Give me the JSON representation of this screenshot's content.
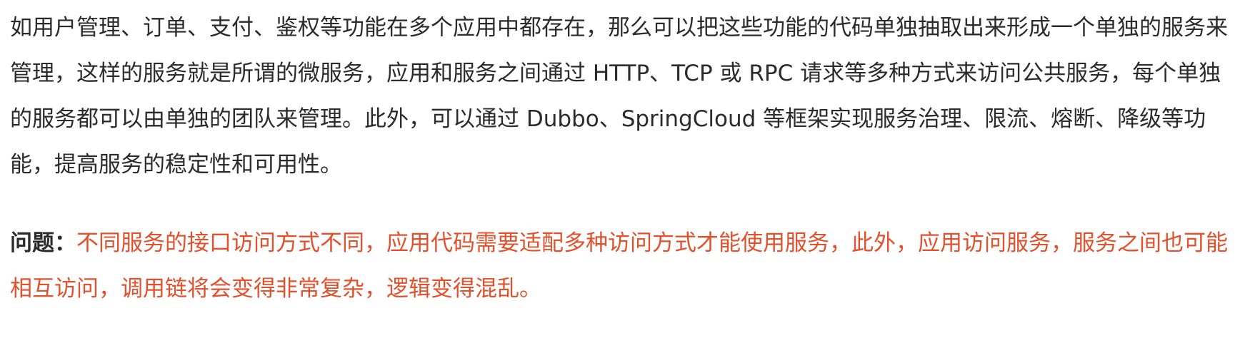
{
  "paragraph_1": "如用户管理、订单、支付、鉴权等功能在多个应用中都存在，那么可以把这些功能的代码单独抽取出来形成一个单独的服务来管理，这样的服务就是所谓的微服务，应用和服务之间通过 HTTP、TCP 或 RPC 请求等多种方式来访问公共服务，每个单独的服务都可以由单独的团队来管理。此外，可以通过 Dubbo、SpringCloud 等框架实现服务治理、限流、熔断、降级等功能，提高服务的稳定性和可用性。",
  "problem": {
    "label": "问题：",
    "text": "不同服务的接口访问方式不同，应用代码需要适配多种访问方式才能使用服务，此外，应用访问服务，服务之间也可能相互访问，调用链将会变得非常复杂，逻辑变得混乱。"
  },
  "colors": {
    "body_text": "#2b2b2b",
    "highlight_text": "#e2502c"
  }
}
